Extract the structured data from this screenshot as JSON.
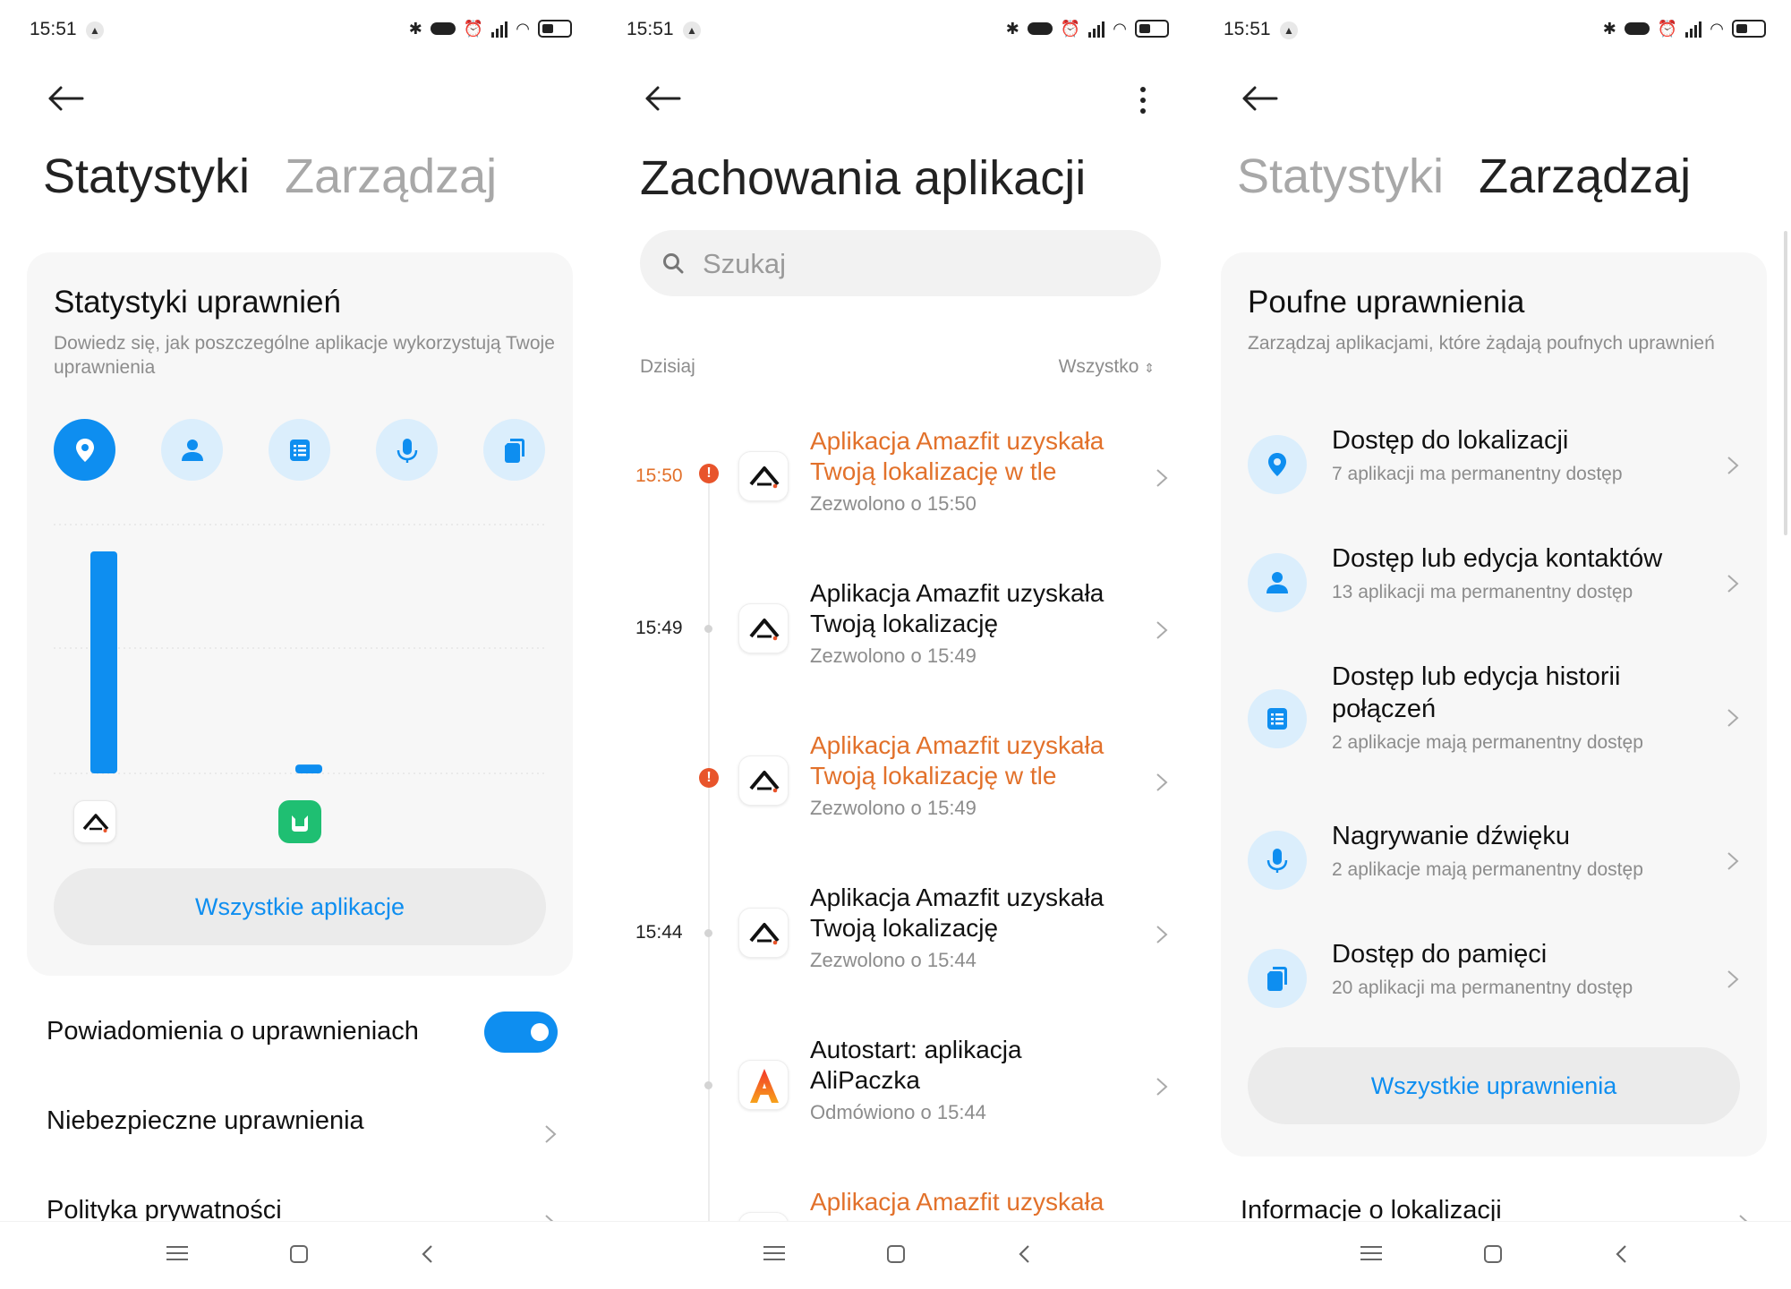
{
  "status_bar": {
    "time": "15:51"
  },
  "screen1": {
    "tabs": {
      "active": "Statystyki",
      "inactive": "Zarządzaj"
    },
    "card": {
      "title": "Statystyki uprawnień",
      "subtitle": "Dowiedz się, jak poszczególne aplikacje wykorzystują Twoje uprawnienia",
      "permission_icons": [
        "location-icon",
        "contacts-icon",
        "call-log-icon",
        "microphone-icon",
        "storage-icon"
      ],
      "all_apps_button": "Wszystkie aplikacje"
    },
    "rows": {
      "notifications": "Powiadomienia o uprawnieniach",
      "dangerous": "Niebezpieczne uprawnienia",
      "privacy": "Polityka prywatności"
    },
    "toggle_on": true
  },
  "chart_data": {
    "type": "bar",
    "categories": [
      "Amazfit",
      "Mi Home"
    ],
    "values": [
      100,
      4
    ],
    "ylim": [
      0,
      100
    ],
    "grid": true,
    "bar_color": "#0e8ef0"
  },
  "screen2": {
    "title": "Zachowania aplikacji",
    "search_placeholder": "Szukaj",
    "section": "Dzisiaj",
    "filter": "Wszystko",
    "events": [
      {
        "time": "15:50",
        "warn": true,
        "title": "Aplikacja Amazfit uzyskała Twoją lokalizację w tle",
        "sub": "Zezwolono o 15:50",
        "icon": "amazfit-icon"
      },
      {
        "time": "15:49",
        "warn": false,
        "title": "Aplikacja Amazfit uzyskała Twoją lokalizację",
        "sub": "Zezwolono o 15:49",
        "icon": "amazfit-icon"
      },
      {
        "time": "",
        "warn": true,
        "title": "Aplikacja Amazfit uzyskała Twoją lokalizację w tle",
        "sub": "Zezwolono o 15:49",
        "icon": "amazfit-icon"
      },
      {
        "time": "15:44",
        "warn": false,
        "title": "Aplikacja Amazfit uzyskała Twoją lokalizację",
        "sub": "Zezwolono o 15:44",
        "icon": "amazfit-icon"
      },
      {
        "time": "",
        "warn": false,
        "title": "Autostart: aplikacja AliPaczka",
        "sub": "Odmówiono o 15:44",
        "icon": "alipaczka-icon"
      },
      {
        "time": "",
        "warn": true,
        "title": "Aplikacja Amazfit uzyskała",
        "sub": "",
        "icon": "amazfit-icon"
      }
    ]
  },
  "screen3": {
    "tabs": {
      "inactive": "Statystyki",
      "active": "Zarządzaj"
    },
    "card": {
      "title": "Poufne uprawnienia",
      "subtitle": "Zarządzaj aplikacjami, które żądają poufnych uprawnień",
      "items": [
        {
          "title": "Dostęp do lokalizacji",
          "sub": "7 aplikacji ma permanentny dostęp",
          "icon": "location-icon"
        },
        {
          "title": "Dostęp lub edycja kontaktów",
          "sub": "13 aplikacji ma permanentny dostęp",
          "icon": "contacts-icon"
        },
        {
          "title": "Dostęp lub edycja historii połączeń",
          "sub": "2 aplikacje mają permanentny dostęp",
          "icon": "call-log-icon"
        },
        {
          "title": "Nagrywanie dźwięku",
          "sub": "2 aplikacje mają permanentny dostęp",
          "icon": "microphone-icon"
        },
        {
          "title": "Dostęp do pamięci",
          "sub": "20 aplikacji ma permanentny dostęp",
          "icon": "storage-icon"
        }
      ],
      "all_button": "Wszystkie uprawnienia"
    },
    "footer_row": "Informacje o lokalizacji"
  },
  "colors": {
    "accent": "#0e8ef0",
    "warning": "#e2712b",
    "alert": "#e8542b",
    "icon_bg": "#dbeefc"
  }
}
